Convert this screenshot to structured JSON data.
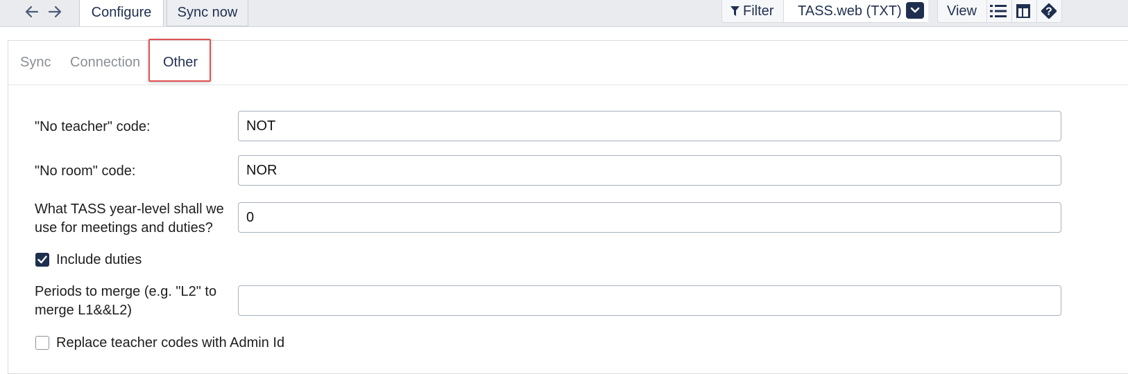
{
  "toolbar": {
    "tabs": [
      {
        "label": "Configure",
        "active": true
      },
      {
        "label": "Sync now",
        "active": false
      }
    ],
    "filter_label": "Filter",
    "source_label": "TASS.web (TXT)",
    "view_label": "View",
    "icons": [
      "back-arrow-icon",
      "forward-arrow-icon",
      "filter-icon",
      "chevron-down-icon",
      "list-view-icon",
      "table-layout-icon",
      "help-icon"
    ]
  },
  "subtabs": [
    {
      "label": "Sync"
    },
    {
      "label": "Connection"
    },
    {
      "label": "Other"
    }
  ],
  "form": {
    "no_teacher": {
      "label": "\"No teacher\" code:",
      "value": "NOT"
    },
    "no_room": {
      "label": "\"No room\" code:",
      "value": "NOR"
    },
    "year_level": {
      "label_line1": "What TASS year-level shall we",
      "label_line2": "use for meetings and duties?",
      "value": "0"
    },
    "include_duties": {
      "label": "Include duties",
      "checked": true
    },
    "periods_merge": {
      "label_line1": "Periods to merge (e.g. \"L2\" to",
      "label_line2": "merge L1&&L2)",
      "value": ""
    },
    "replace_teacher": {
      "label": "Replace teacher codes with Admin Id",
      "checked": false
    }
  },
  "colors": {
    "accent": "#1f2f4f",
    "highlight": "#e05252"
  }
}
